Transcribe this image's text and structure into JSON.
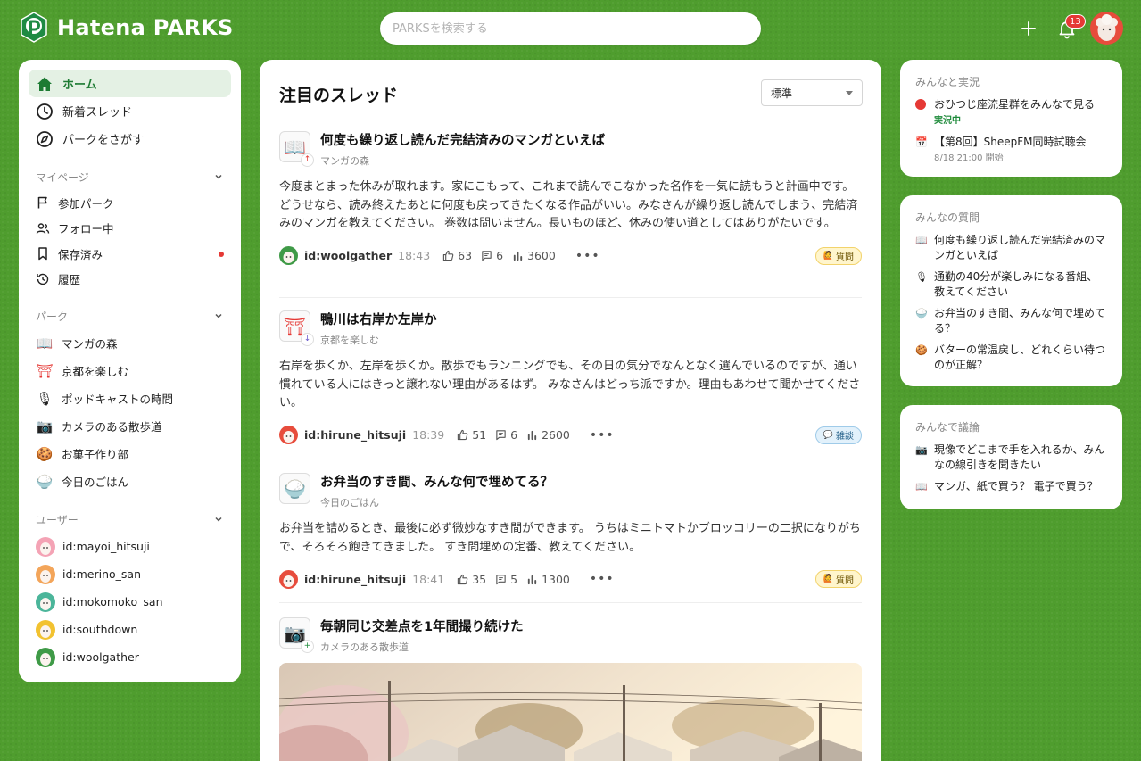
{
  "app": {
    "name": "Hatena PARKS"
  },
  "header": {
    "search_placeholder": "PARKSを検索する",
    "notification_count": "13"
  },
  "sidebar": {
    "nav": [
      {
        "label": "ホーム",
        "icon": "home-icon"
      },
      {
        "label": "新着スレッド",
        "icon": "clock-icon"
      },
      {
        "label": "パークをさがす",
        "icon": "compass-icon"
      }
    ],
    "mypage": {
      "title": "マイページ",
      "items": [
        {
          "label": "参加パーク",
          "icon": "flag-icon"
        },
        {
          "label": "フォロー中",
          "icon": "people-icon"
        },
        {
          "label": "保存済み",
          "icon": "bookmark-icon"
        },
        {
          "label": "履歴",
          "icon": "history-icon"
        }
      ]
    },
    "parks": {
      "title": "パーク",
      "items": [
        {
          "label": "マンガの森",
          "icon": "📖"
        },
        {
          "label": "京都を楽しむ",
          "icon": "⛩"
        },
        {
          "label": "ポッドキャストの時間",
          "icon": "🎙"
        },
        {
          "label": "カメラのある散歩道",
          "icon": "📷"
        },
        {
          "label": "お菓子作り部",
          "icon": "🍪"
        },
        {
          "label": "今日のごはん",
          "icon": "🍚"
        }
      ]
    },
    "users": {
      "title": "ユーザー",
      "items": [
        {
          "label": "id:mayoi_hitsuji"
        },
        {
          "label": "id:merino_san"
        },
        {
          "label": "id:mokomoko_san"
        },
        {
          "label": "id:southdown"
        },
        {
          "label": "id:woolgather"
        }
      ]
    }
  },
  "main": {
    "title": "注目のスレッド",
    "sort": "標準",
    "threads": [
      {
        "icon": "📖",
        "badge": "↑",
        "title": "何度も繰り返し読んだ完結済みのマンガといえば",
        "park": "マンガの森",
        "body": "今度まとまった休みが取れます。家にこもって、これまで読んでこなかった名作を一気に読もうと計画中です。 どうせなら、読み終えたあとに何度も戻ってきたくなる作品がいい。みなさんが繰り返し読んでしまう、完結済みのマンガを教えてください。 巻数は問いません。長いものほど、休みの使い道としてはありがたいです。",
        "user": "id:woolgather",
        "time": "18:43",
        "likes": "63",
        "comments": "6",
        "views": "3600",
        "tag": "質問",
        "tag_icon": "🙋"
      },
      {
        "icon": "⛩",
        "badge": "↓",
        "title": "鴨川は右岸か左岸か",
        "park": "京都を楽しむ",
        "body": "右岸を歩くか、左岸を歩くか。散歩でもランニングでも、その日の気分でなんとなく選んでいるのですが、通い慣れている人にはきっと譲れない理由があるはず。 みなさんはどっち派ですか。理由もあわせて聞かせてください。",
        "user": "id:hirune_hitsuji",
        "time": "18:39",
        "likes": "51",
        "comments": "6",
        "views": "2600",
        "tag": "雑談",
        "tag_icon": "💬"
      },
      {
        "icon": "🍚",
        "badge": "",
        "title": "お弁当のすき間、みんな何で埋めてる？",
        "park": "今日のごはん",
        "body": "お弁当を詰めるとき、最後に必ず微妙なすき間ができます。 うちはミニトマトかブロッコリーの二択になりがちで、そろそろ飽きてきました。 すき間埋めの定番、教えてください。",
        "user": "id:hirune_hitsuji",
        "time": "18:41",
        "likes": "35",
        "comments": "5",
        "views": "1300",
        "tag": "質問",
        "tag_icon": "🙋"
      },
      {
        "icon": "📷",
        "badge": "+",
        "title": "毎朝同じ交差点を1年間撮り続けた",
        "park": "カメラのある散歩道"
      }
    ]
  },
  "right": {
    "live": {
      "title": "みんなと実況",
      "items": [
        {
          "label": "おひつじ座流星群をみんなで見る",
          "sub": "実況中",
          "icon": "live-dot"
        },
        {
          "label": "【第8回】SheepFM同時試聴会",
          "sub": "8/18 21:00 開始",
          "icon": "📅"
        }
      ]
    },
    "questions": {
      "title": "みんなの質問",
      "items": [
        {
          "label": "何度も繰り返し読んだ完結済みのマンガといえば",
          "icon": "📖"
        },
        {
          "label": "通勤の40分が楽しみになる番組、教えてください",
          "icon": "🎙"
        },
        {
          "label": "お弁当のすき間、みんな何で埋めてる？",
          "icon": "🍚"
        },
        {
          "label": "バターの常温戻し、どれくらい待つのが正解？",
          "icon": "🍪"
        }
      ]
    },
    "discuss": {
      "title": "みんなで議論",
      "items": [
        {
          "label": "現像でどこまで手を入れるか、みんなの線引きを聞きたい",
          "icon": "📷"
        },
        {
          "label": "マンガ、紙で買う？ 電子で買う？",
          "icon": "📖"
        }
      ]
    }
  },
  "colors": {
    "bg_green": "#4f9d2e",
    "accent": "#1d7b33",
    "badge_red": "#e53935"
  }
}
